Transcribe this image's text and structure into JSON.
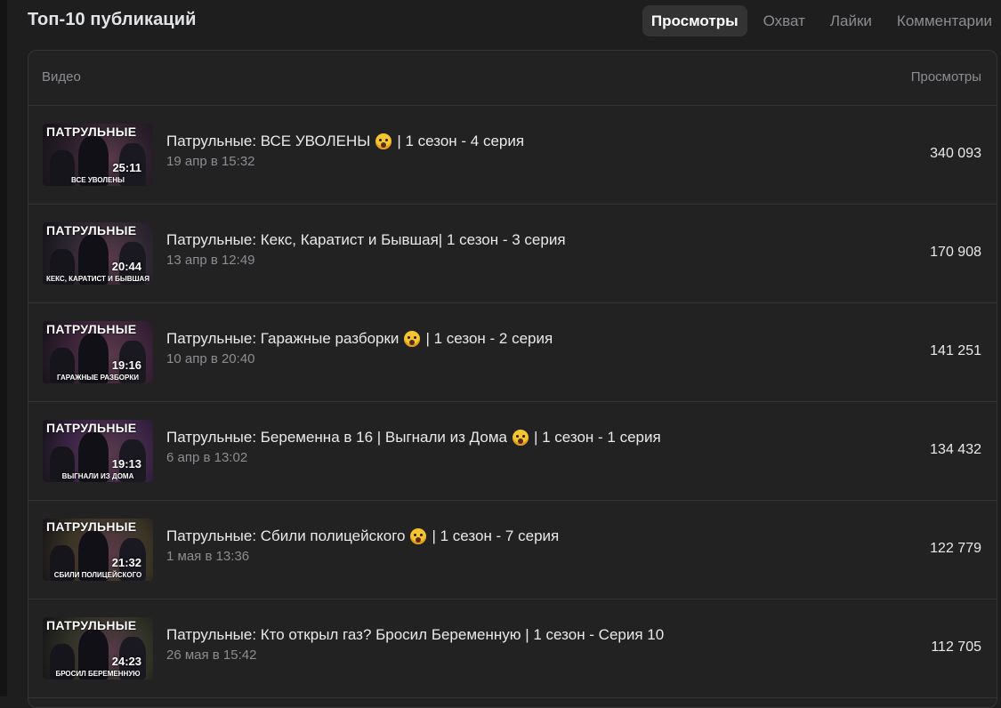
{
  "header": {
    "title": "Топ-10 публикаций",
    "tabs": [
      {
        "label": "Просмотры",
        "active": true
      },
      {
        "label": "Охват",
        "active": false
      },
      {
        "label": "Лайки",
        "active": false
      },
      {
        "label": "Комментарии",
        "active": false
      }
    ]
  },
  "table": {
    "columns": {
      "video": "Видео",
      "views": "Просмотры"
    },
    "rows": [
      {
        "title_pre": "Патрульные: ВСЕ УВОЛЕНЫ",
        "emoji": "😱",
        "title_post": "| 1 сезон - 4 серия",
        "date": "19 апр в 15:32",
        "views": "340 093",
        "thumb": {
          "brand": "ПАТРУЛЬНЫЕ",
          "duration": "25:11",
          "caption": "ВСЕ УВОЛЕНЫ",
          "bg": "#2a1f2a"
        }
      },
      {
        "title_pre": "Патрульные: Кекс, Каратист и Бывшая| 1 сезон - 3 серия",
        "emoji": "",
        "title_post": "",
        "date": "13 апр в 12:49",
        "views": "170 908",
        "thumb": {
          "brand": "ПАТРУЛЬНЫЕ",
          "duration": "20:44",
          "caption": "КЕКС, КАРАТИСТ И БЫВШАЯ",
          "bg": "#2c2630"
        }
      },
      {
        "title_pre": "Патрульные: Гаражные разборки",
        "emoji": "😱",
        "title_post": "| 1 сезон - 2 серия",
        "date": "10 апр в 20:40",
        "views": "141 251",
        "thumb": {
          "brand": "ПАТРУЛЬНЫЕ",
          "duration": "19:16",
          "caption": "ГАРАЖНЫЕ РАЗБОРКИ",
          "bg": "#3a2238"
        }
      },
      {
        "title_pre": "Патрульные: Беременна в 16 | Выгнали из Дома",
        "emoji": "😱",
        "title_post": "| 1 сезон - 1 серия",
        "date": "6 апр в 13:02",
        "views": "134 432",
        "thumb": {
          "brand": "ПАТРУЛЬНЫЕ",
          "duration": "19:13",
          "caption": "ВЫГНАЛИ ИЗ ДОМА",
          "bg": "#3b2446"
        }
      },
      {
        "title_pre": "Патрульные: Сбили полицейского",
        "emoji": "😱",
        "title_post": "| 1 сезон - 7 серия",
        "date": "1 мая в 13:36",
        "views": "122 779",
        "thumb": {
          "brand": "ПАТРУЛЬНЫЕ",
          "duration": "21:32",
          "caption": "СБИЛИ ПОЛИЦЕЙСКОГО",
          "bg": "#3a3424"
        }
      },
      {
        "title_pre": "Патрульные: Кто открыл газ? Бросил Беременную | 1 сезон - Серия 10",
        "emoji": "",
        "title_post": "",
        "date": "26 мая в 15:42",
        "views": "112 705",
        "thumb": {
          "brand": "ПАТРУЛЬНЫЕ",
          "duration": "24:23",
          "caption": "БРОСИЛ БЕРЕМЕННУЮ",
          "bg": "#2f3226"
        }
      }
    ]
  }
}
